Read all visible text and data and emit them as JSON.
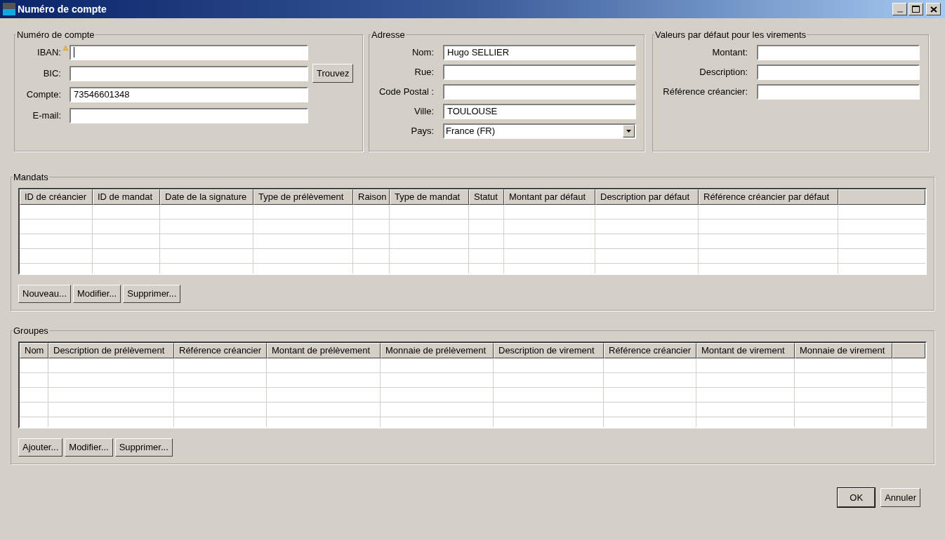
{
  "window": {
    "title": "Numéro de compte"
  },
  "account": {
    "legend": "Numéro de compte",
    "fields": [
      {
        "label": "IBAN:",
        "warning": true,
        "focused": true
      },
      {
        "label": "BIC:",
        "warning": false,
        "focused": false,
        "button": "Trouvez"
      },
      {
        "label": "Compte:",
        "value": "73546601348",
        "warning": false,
        "focused": false
      },
      {
        "label": "E-mail:",
        "warning": false,
        "focused": false
      }
    ]
  },
  "address": {
    "legend": "Adresse",
    "fields": [
      {
        "kind": "text",
        "label": "Nom:",
        "value": "Hugo SELLIER"
      },
      {
        "kind": "text",
        "label": "Rue:"
      },
      {
        "kind": "text",
        "label": "Code Postal :"
      },
      {
        "kind": "text",
        "label": "Ville:",
        "value": "TOULOUSE"
      },
      {
        "kind": "select",
        "label": "Pays:",
        "value": "France (FR)"
      }
    ]
  },
  "transfer_defaults": {
    "legend": "Valeurs par défaut pour les virements",
    "fields": [
      {
        "label": "Montant:"
      },
      {
        "label": "Description:"
      },
      {
        "label": "Référence créancier:"
      }
    ]
  },
  "mandates": {
    "legend": "Mandats",
    "columns": [
      "ID de créancier",
      "ID de mandat",
      "Date de la signature",
      "Type de prélèvement",
      "Raison",
      "Type de mandat",
      "Statut",
      "Montant par défaut",
      "Description par défaut",
      "Référence créancier par défaut"
    ],
    "buttons": [
      "Nouveau...",
      "Modifier...",
      "Supprimer..."
    ]
  },
  "groups": {
    "legend": "Groupes",
    "columns": [
      "Nom",
      "Description de prélèvement",
      "Référence créancier",
      "Montant de prélèvement",
      "Monnaie de prélèvement",
      "Description de virement",
      "Référence créancier",
      "Montant de virement",
      "Monnaie de virement"
    ],
    "buttons": [
      "Ajouter...",
      "Modifier...",
      "Supprimer..."
    ]
  },
  "footer": {
    "buttons": [
      {
        "label": "OK",
        "default": true
      },
      {
        "label": "Annuler",
        "default": false
      }
    ]
  }
}
